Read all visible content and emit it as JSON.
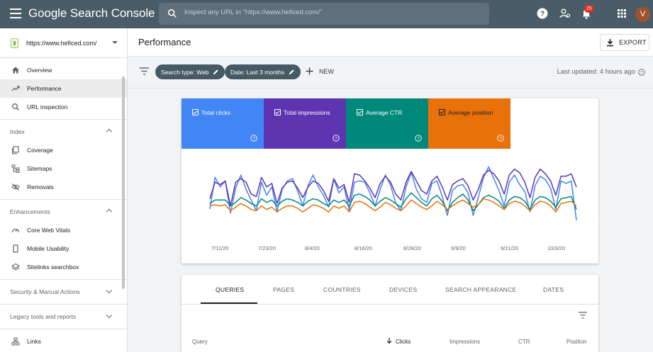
{
  "app": {
    "title": "Google Search Console",
    "search_placeholder": "Inspect any URL in \"https://www.heficed.com/\"",
    "notification_count": "25",
    "avatar_initial": "V"
  },
  "sidebar": {
    "property": "https://www.heficed.com/",
    "top_items": [
      {
        "label": "Overview",
        "icon": "home-icon"
      },
      {
        "label": "Performance",
        "icon": "trending-up-icon",
        "active": true
      },
      {
        "label": "URL inspection",
        "icon": "search-icon"
      }
    ],
    "sections": [
      {
        "label": "Index",
        "expanded": true,
        "items": [
          {
            "label": "Coverage",
            "icon": "coverage-icon"
          },
          {
            "label": "Sitemaps",
            "icon": "sitemap-icon"
          },
          {
            "label": "Removals",
            "icon": "eye-off-icon"
          }
        ]
      },
      {
        "label": "Enhancements",
        "expanded": true,
        "items": [
          {
            "label": "Core Web Vitals",
            "icon": "gauge-icon"
          },
          {
            "label": "Mobile Usability",
            "icon": "phone-icon"
          },
          {
            "label": "Sitelinks searchbox",
            "icon": "layers-icon"
          }
        ]
      },
      {
        "label": "Security & Manual Actions",
        "expanded": false,
        "items": []
      },
      {
        "label": "Legacy tools and reports",
        "expanded": false,
        "items": []
      }
    ],
    "bottom_items": [
      {
        "label": "Links",
        "icon": "links-icon"
      }
    ]
  },
  "header": {
    "title": "Performance",
    "export_label": "EXPORT"
  },
  "filters": {
    "chips": [
      "Search type: Web",
      "Date: Last 3 months"
    ],
    "new_label": "NEW",
    "last_updated": "Last updated: 4 hours ago"
  },
  "metrics": [
    {
      "label": "Total clicks",
      "color": "#4285f4"
    },
    {
      "label": "Total impressions",
      "color": "#5e35b1"
    },
    {
      "label": "Average CTR",
      "color": "#00897b"
    },
    {
      "label": "Average position",
      "color": "#e8710a"
    }
  ],
  "chart_data": {
    "type": "line",
    "x_ticks": [
      "7/11/20",
      "7/23/20",
      "8/4/20",
      "8/16/20",
      "8/28/20",
      "9/9/20",
      "9/21/20",
      "10/3/20"
    ],
    "series": [
      {
        "name": "Total clicks",
        "color": "#4285f4",
        "values": [
          0.25,
          0.78,
          0.62,
          0.72,
          0.18,
          0.6,
          0.82,
          0.58,
          0.4,
          0.22,
          0.7,
          0.48,
          0.62,
          0.2,
          0.58,
          0.72,
          0.76,
          0.55,
          0.3,
          0.64,
          0.82,
          0.62,
          0.48,
          0.28,
          0.75,
          0.52,
          0.62,
          0.22,
          0.7,
          0.72,
          0.7,
          0.52,
          0.3,
          0.58,
          0.82,
          0.65,
          0.35,
          0.22,
          0.62,
          0.86,
          0.58,
          0.42,
          0.36,
          0.68,
          0.72,
          0.46,
          0.14,
          0.56,
          0.64,
          0.66,
          0.52,
          0.14,
          0.44,
          0.78,
          0.96,
          0.76,
          0.56,
          0.3,
          0.7,
          0.82,
          0.66,
          0.54,
          0.2,
          0.64,
          0.8,
          0.74,
          0.6,
          0.24,
          0.72,
          0.68,
          0.72,
          0.06
        ]
      },
      {
        "name": "Total impressions",
        "color": "#5e35b1",
        "values": [
          0.42,
          0.7,
          0.66,
          0.72,
          0.3,
          0.7,
          0.76,
          0.7,
          0.5,
          0.46,
          0.78,
          0.62,
          0.68,
          0.34,
          0.6,
          0.7,
          0.72,
          0.6,
          0.44,
          0.62,
          0.72,
          0.68,
          0.56,
          0.38,
          0.76,
          0.6,
          0.66,
          0.36,
          0.84,
          0.82,
          0.72,
          0.6,
          0.44,
          0.68,
          0.8,
          0.7,
          0.5,
          0.4,
          0.7,
          0.88,
          0.72,
          0.56,
          0.5,
          0.72,
          0.8,
          0.62,
          0.4,
          0.66,
          0.72,
          0.76,
          0.64,
          0.4,
          0.58,
          0.82,
          0.9,
          0.84,
          0.72,
          0.5,
          0.82,
          0.92,
          0.86,
          0.7,
          0.44,
          0.78,
          0.92,
          0.84,
          0.72,
          0.48,
          0.8,
          0.8,
          0.84,
          0.62
        ]
      },
      {
        "name": "Average CTR",
        "color": "#00897b",
        "values": [
          0.34,
          0.4,
          0.4,
          0.4,
          0.3,
          0.36,
          0.44,
          0.4,
          0.34,
          0.3,
          0.42,
          0.36,
          0.4,
          0.3,
          0.38,
          0.42,
          0.4,
          0.36,
          0.3,
          0.38,
          0.42,
          0.4,
          0.34,
          0.3,
          0.4,
          0.36,
          0.4,
          0.3,
          0.48,
          0.5,
          0.46,
          0.4,
          0.3,
          0.38,
          0.44,
          0.4,
          0.34,
          0.28,
          0.42,
          0.52,
          0.44,
          0.36,
          0.3,
          0.42,
          0.48,
          0.38,
          0.22,
          0.36,
          0.44,
          0.5,
          0.4,
          0.22,
          0.32,
          0.44,
          0.48,
          0.44,
          0.38,
          0.26,
          0.4,
          0.46,
          0.44,
          0.38,
          0.24,
          0.4,
          0.46,
          0.44,
          0.38,
          0.28,
          0.42,
          0.44,
          0.46,
          0.24
        ]
      },
      {
        "name": "Average position",
        "color": "#e8710a",
        "values": [
          0.3,
          0.32,
          0.3,
          0.32,
          0.22,
          0.28,
          0.34,
          0.3,
          0.24,
          0.22,
          0.3,
          0.24,
          0.28,
          0.2,
          0.26,
          0.3,
          0.3,
          0.26,
          0.2,
          0.26,
          0.32,
          0.3,
          0.26,
          0.2,
          0.3,
          0.26,
          0.3,
          0.2,
          0.36,
          0.38,
          0.34,
          0.28,
          0.22,
          0.28,
          0.36,
          0.32,
          0.26,
          0.22,
          0.3,
          0.4,
          0.34,
          0.28,
          0.24,
          0.3,
          0.38,
          0.32,
          0.24,
          0.3,
          0.36,
          0.4,
          0.34,
          0.28,
          0.32,
          0.42,
          0.4,
          0.36,
          0.3,
          0.24,
          0.34,
          0.38,
          0.36,
          0.3,
          0.22,
          0.32,
          0.38,
          0.36,
          0.3,
          0.2,
          0.34,
          0.36,
          0.38,
          0.3
        ]
      }
    ]
  },
  "table": {
    "tabs": [
      "QUERIES",
      "PAGES",
      "COUNTRIES",
      "DEVICES",
      "SEARCH APPEARANCE",
      "DATES"
    ],
    "active_tab": "QUERIES",
    "columns": [
      "Query",
      "Clicks",
      "Impressions",
      "CTR",
      "Position"
    ],
    "sorted_column": "Clicks"
  }
}
